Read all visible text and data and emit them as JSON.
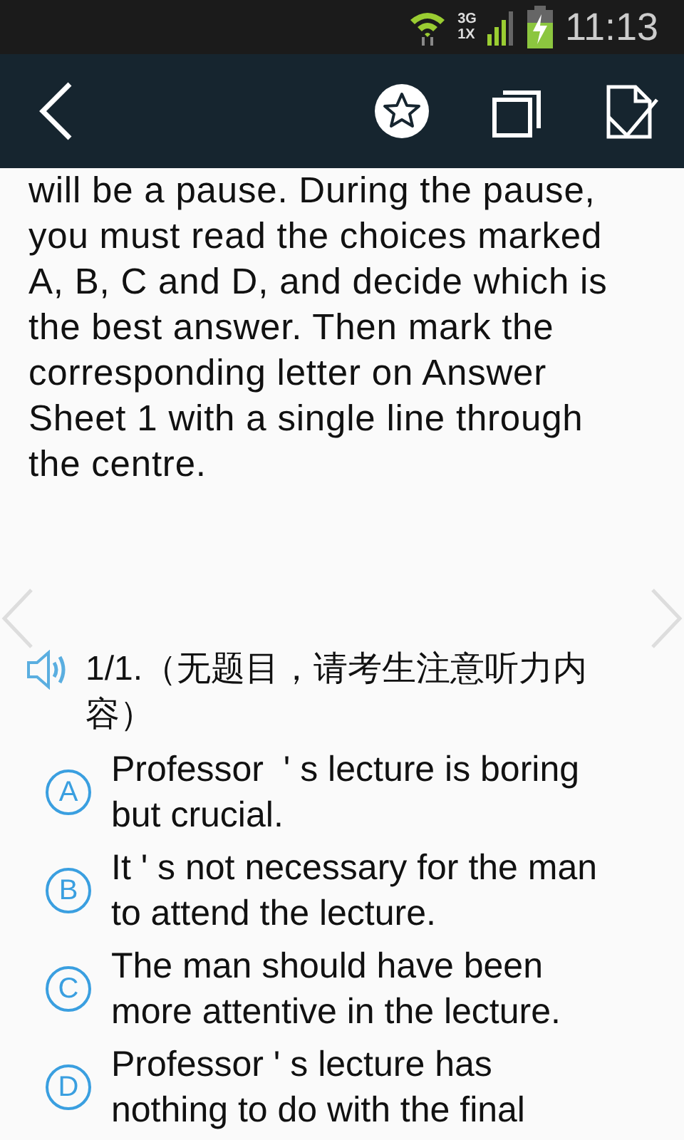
{
  "status_bar": {
    "network_top": "3G",
    "network_bottom": "1X",
    "time": "11:13"
  },
  "toolbar": {
    "back": true,
    "favorite": false
  },
  "passage": "will be a pause. During the pause, you must read the choices marked A, B, C and D, and decide which is the best answer. Then mark the corresponding letter on Answer Sheet 1 with a single line through the centre.",
  "question": {
    "text": "1/1.（无题目，请考生注意听力内容）"
  },
  "options": [
    {
      "letter": "A",
      "text": "Professor  ' s lecture is boring but crucial.",
      "selected": false
    },
    {
      "letter": "B",
      "text": "It ' s not necessary for the man to attend the lecture.",
      "selected": false
    },
    {
      "letter": "C",
      "text": "The man should have been more attentive in the lecture.",
      "selected": false
    },
    {
      "letter": "D",
      "text": "Professor ' s lecture has nothing to do with the final",
      "selected": false
    }
  ]
}
